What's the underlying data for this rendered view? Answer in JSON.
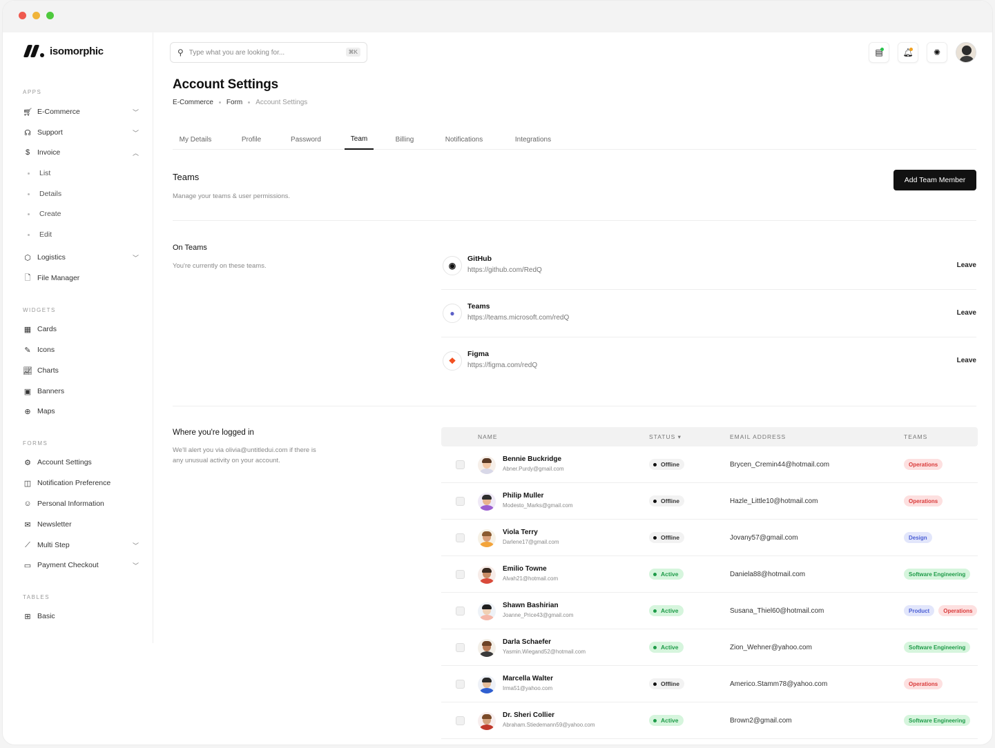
{
  "brand": {
    "name": "isomorphic"
  },
  "sidebar": {
    "sections": {
      "apps": "APPS",
      "widgets": "WIDGETS",
      "forms": "FORMS",
      "tables": "TABLES"
    },
    "apps": [
      {
        "label": "E-Commerce",
        "icon": "cart-icon"
      },
      {
        "label": "Support",
        "icon": "headset-icon"
      },
      {
        "label": "Invoice",
        "icon": "dollar-icon"
      }
    ],
    "invoice_sub": [
      "List",
      "Details",
      "Create",
      "Edit"
    ],
    "apps2": [
      {
        "label": "Logistics",
        "icon": "package-icon"
      },
      {
        "label": "File Manager",
        "icon": "file-icon"
      }
    ],
    "widgets": [
      {
        "label": "Cards"
      },
      {
        "label": "Icons"
      },
      {
        "label": "Charts"
      },
      {
        "label": "Banners"
      },
      {
        "label": "Maps"
      }
    ],
    "forms": [
      {
        "label": "Account Settings"
      },
      {
        "label": "Notification Preference"
      },
      {
        "label": "Personal Information"
      },
      {
        "label": "Newsletter"
      },
      {
        "label": "Multi Step"
      },
      {
        "label": "Payment Checkout"
      }
    ],
    "tables": [
      {
        "label": "Basic"
      }
    ]
  },
  "header": {
    "search_placeholder": "Type what you are looking for...",
    "search_shortcut": "⌘K"
  },
  "page": {
    "title": "Account Settings",
    "breadcrumb": [
      "E-Commerce",
      "Form",
      "Account Settings"
    ]
  },
  "tabs": [
    "My Details",
    "Profile",
    "Password",
    "Team",
    "Billing",
    "Notifications",
    "Integrations"
  ],
  "teams_section": {
    "title": "Teams",
    "subtitle": "Manage your teams & user permissions.",
    "add_button": "Add Team Member"
  },
  "on_teams": {
    "title": "On Teams",
    "subtitle": "You're currently on these teams.",
    "leave_label": "Leave",
    "items": [
      {
        "name": "GitHub",
        "url": "https://github.com/RedQ"
      },
      {
        "name": "Teams",
        "url": "https://teams.microsoft.com/redQ"
      },
      {
        "name": "Figma",
        "url": "https://figma.com/redQ"
      }
    ]
  },
  "logged_in": {
    "title": "Where you're logged in",
    "subtitle_line1": "We'll alert you via olivia@untitledui.com if there is",
    "subtitle_line2": "any unusual activity on your account."
  },
  "table": {
    "headers": {
      "name": "NAME",
      "status": "STATUS ▾",
      "email": "EMAIL ADDRESS",
      "teams": "TEAMS"
    },
    "rows": [
      {
        "name": "Bennie Buckridge",
        "sub": "Abner.Purdy@gmail.com",
        "status": "Offline",
        "email": "Brycen_Cremin44@hotmail.com",
        "teams": [
          "Operations"
        ]
      },
      {
        "name": "Philip Muller",
        "sub": "Modesto_Marks@gmail.com",
        "status": "Offline",
        "email": "Hazle_Little10@hotmail.com",
        "teams": [
          "Operations"
        ]
      },
      {
        "name": "Viola Terry",
        "sub": "Darlene17@gmail.com",
        "status": "Offline",
        "email": "Jovany57@gmail.com",
        "teams": [
          "Design"
        ]
      },
      {
        "name": "Emilio Towne",
        "sub": "Alvah21@hotmail.com",
        "status": "Active",
        "email": "Daniela88@hotmail.com",
        "teams": [
          "Software Engineering"
        ]
      },
      {
        "name": "Shawn Bashirian",
        "sub": "Joanne_Price43@gmail.com",
        "status": "Active",
        "email": "Susana_Thiel60@hotmail.com",
        "teams": [
          "Product",
          "Operations"
        ]
      },
      {
        "name": "Darla Schaefer",
        "sub": "Yasmin.Wiegand52@hotmail.com",
        "status": "Active",
        "email": "Zion_Wehner@yahoo.com",
        "teams": [
          "Software Engineering"
        ]
      },
      {
        "name": "Marcella Walter",
        "sub": "Irma51@yahoo.com",
        "status": "Offline",
        "email": "Americo.Stamm78@yahoo.com",
        "teams": [
          "Operations"
        ]
      },
      {
        "name": "Dr. Sheri Collier",
        "sub": "Abraham.Stiedemann59@yahoo.com",
        "status": "Active",
        "email": "Brown2@gmail.com",
        "teams": [
          "Software Engineering"
        ]
      }
    ]
  },
  "colors": {
    "accent": "#111111",
    "active_green": "#1e9b48",
    "operations_red": "#d93a3a",
    "product_blue": "#4c5fd5"
  }
}
